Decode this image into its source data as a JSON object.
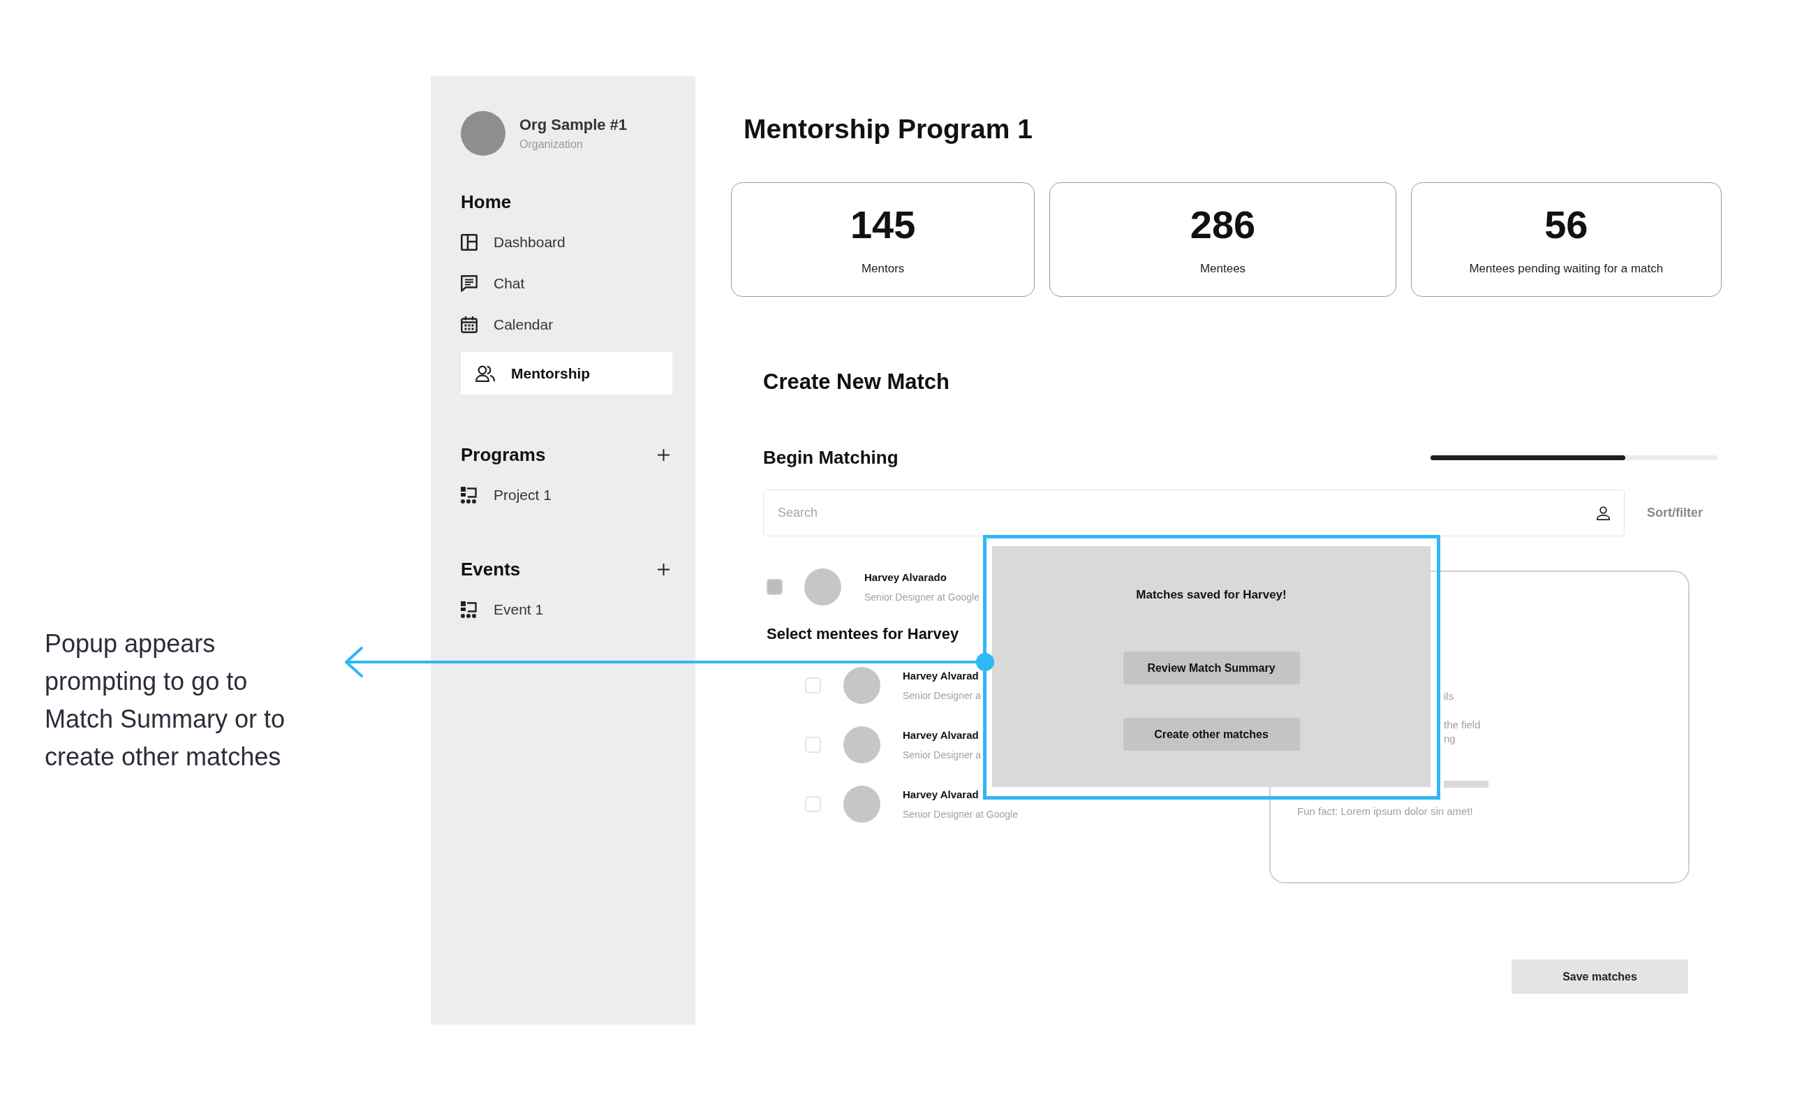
{
  "annotation": {
    "text": "Popup appears prompting to go to Match Summary or to create other matches"
  },
  "sidebar": {
    "org": {
      "name": "Org Sample #1",
      "subtitle": "Organization"
    },
    "sections": [
      {
        "title": "Home",
        "items": [
          {
            "kind": "dashboard",
            "label": "Dashboard",
            "selected": false
          },
          {
            "kind": "chat",
            "label": "Chat",
            "selected": false
          },
          {
            "kind": "calendar",
            "label": "Calendar",
            "selected": false
          },
          {
            "kind": "mentorship",
            "label": "Mentorship",
            "selected": true
          }
        ]
      },
      {
        "title": "Programs",
        "add_button": true,
        "items": [
          {
            "kind": "program",
            "label": "Project 1",
            "selected": false
          }
        ]
      },
      {
        "title": "Events",
        "add_button": true,
        "items": [
          {
            "kind": "event",
            "label": "Event 1",
            "selected": false
          }
        ]
      }
    ]
  },
  "main": {
    "title": "Mentorship Program 1",
    "stats": [
      {
        "value": "145",
        "label": "Mentors"
      },
      {
        "value": "286",
        "label": "Mentees"
      },
      {
        "value": "56",
        "label": "Mentees pending waiting for a match"
      }
    ],
    "match": {
      "title": "Create New Match",
      "step_title": "Begin Matching",
      "progress": {
        "level": 0.68
      },
      "search": {
        "placeholder": "Search"
      },
      "sort_filter": "Sort/filter",
      "mentor": {
        "name": "Harvey Alvarado",
        "subtitle": "Senior Designer at Google",
        "checked": true
      },
      "mentees_title": "Select mentees for Harvey",
      "mentees": [
        {
          "name": "Harvey Alvarad",
          "subtitle": "Senior Designer a",
          "checked": false
        },
        {
          "name": "Harvey Alvarad",
          "subtitle": "Senior Designer a",
          "checked": false
        },
        {
          "name": "Harvey Alvarad",
          "subtitle": "Senior Designer at Google",
          "checked": false
        }
      ],
      "detail_card": {
        "fragments": [
          "ils",
          "the field",
          "ng"
        ],
        "fun_fact": "Fun fact: Lorem ipsum dolor sin amet!"
      },
      "save_button": "Save matches"
    }
  },
  "popup": {
    "message": "Matches saved for Harvey!",
    "buttons": [
      "Review Match Summary",
      "Create other matches"
    ]
  }
}
